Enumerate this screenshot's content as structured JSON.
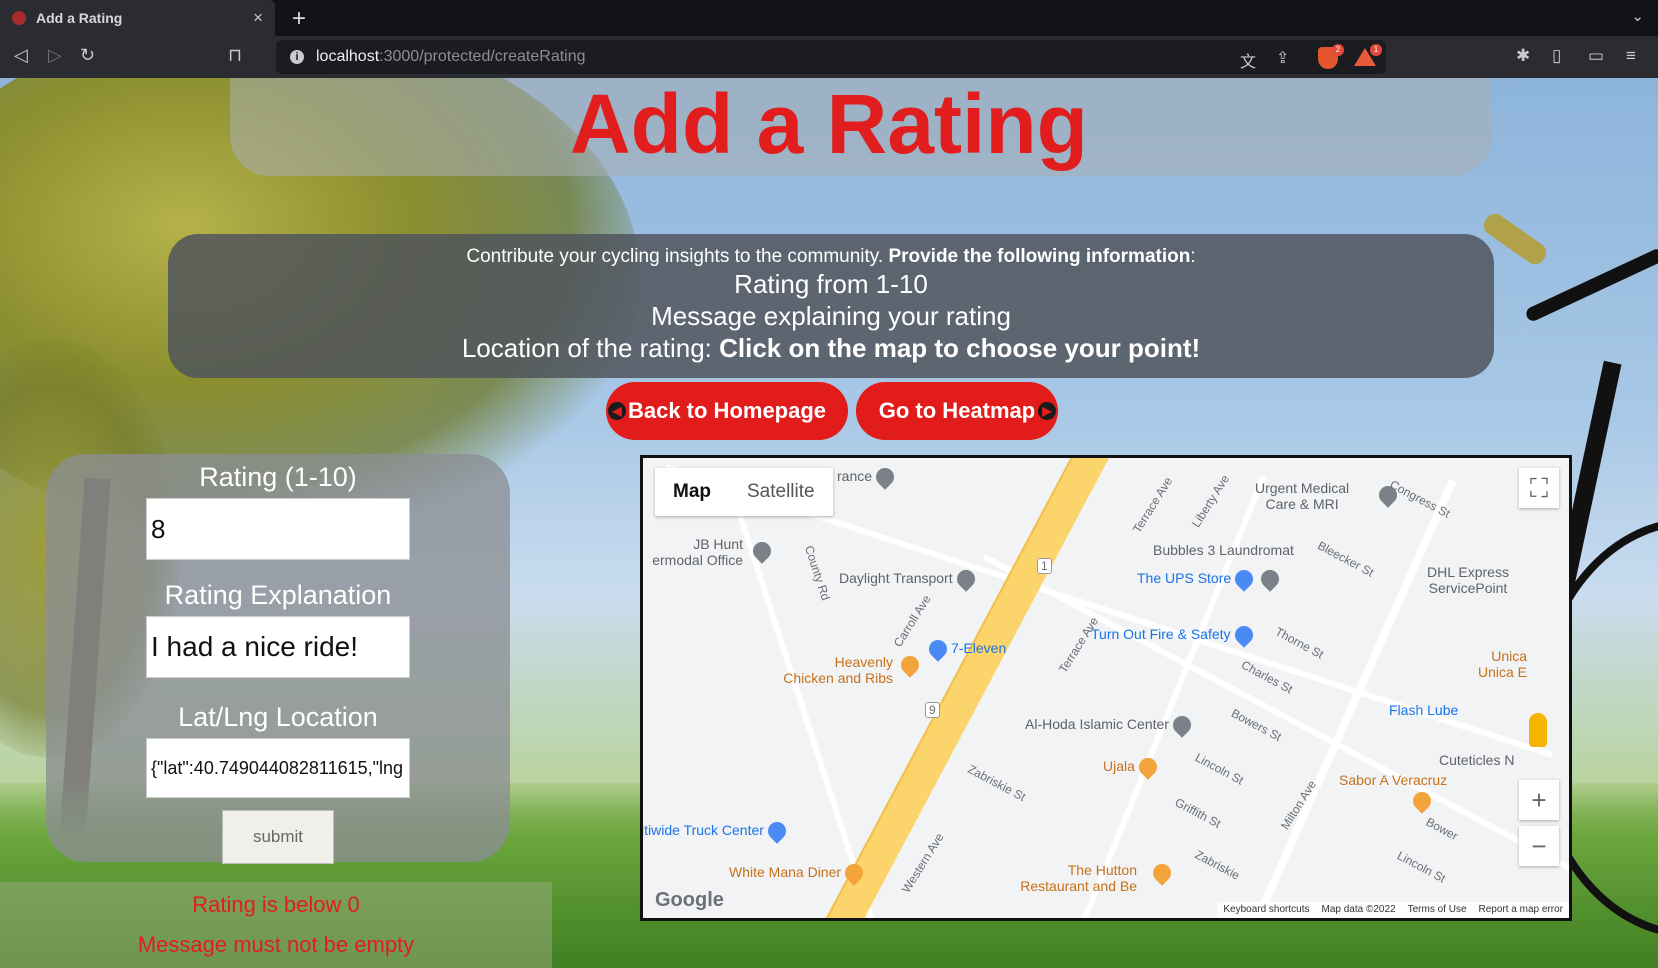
{
  "browser": {
    "tab_title": "Add a Rating",
    "tab_close": "×",
    "new_tab": "+",
    "url_host": "localhost",
    "url_path": ":3000/protected/createRating",
    "shield_badge": "2",
    "rewards_badge": "1"
  },
  "page": {
    "title": "Add a Rating",
    "info_line1_normal": "Contribute your cycling insights to the community. ",
    "info_line1_bold": "Provide the following information",
    "info_line1_colon": ":",
    "info_line2": "Rating from 1-10",
    "info_line3": "Message explaining your rating",
    "info_line4_normal": "Location of the rating: ",
    "info_line4_bold": "Click on the map to choose your point!",
    "back_button": "Back to Homepage",
    "heatmap_button": "Go to Heatmap"
  },
  "form": {
    "rating_label": "Rating (1-10)",
    "rating_value": "8",
    "explanation_label": "Rating Explanation",
    "explanation_value": "I had a nice ride!",
    "location_label": "Lat/Lng Location",
    "location_value": "{\"lat\":40.749044082811615,\"lng",
    "submit_label": "submit"
  },
  "errors": [
    "Rating is below 0",
    "Message must not be empty"
  ],
  "map": {
    "type_map": "Map",
    "type_satellite": "Satellite",
    "zoom_in": "+",
    "zoom_out": "−",
    "fullscreen": "⛶",
    "google": "Google",
    "footer": [
      "Keyboard shortcuts",
      "Map data ©2022",
      "Terms of Use",
      "Report a map error"
    ],
    "places": {
      "p1": "rance",
      "p2": "Urgent Medical",
      "p2b": "Care & MRI",
      "p3": "JB Hunt",
      "p3b": "ermodal Office",
      "p4": "Daylight Transport",
      "p5": "Bubbles 3 Laundromat",
      "p6": "The UPS Store",
      "p7": "DHL Express",
      "p7b": "ServicePoint",
      "p8": "7-Eleven",
      "p9": "Turn Out Fire & Safety",
      "p10": "Heavenly",
      "p10b": "Chicken and Ribs",
      "p11": "Al-Hoda Islamic Center",
      "p12": "Flash Lube",
      "p13": "Unica",
      "p13b": "Unica E",
      "p14": "Cuteticles N",
      "p15": "Ujala",
      "p16": "Sabor A Veracruz",
      "p17": "itiwide Truck Center",
      "p18": "White Mana Diner",
      "p19": "The Hutton",
      "p19b": "Restaurant and Be"
    },
    "streets": {
      "s1": "Terrace Ave",
      "s2": "Liberty Ave",
      "s3": "Congress St",
      "s4": "Bleecker St",
      "s5": "County Rd",
      "s6": "Carroll Ave",
      "s7": "Terrace Ave",
      "s8": "Thorne St",
      "s9": "Charles St",
      "s10": "Bowers St",
      "s11": "Lincoln St",
      "s12": "Zabriskie St",
      "s13": "Griffith St",
      "s14": "Milton Ave",
      "s15": "Western Ave",
      "s16": "Bower",
      "s17": "Lincoln St",
      "s18": "Zabriskie",
      "s19": "1",
      "s20": "9"
    }
  },
  "colors": {
    "title_red": "#e11d1d",
    "button_red": "#e21b1b",
    "highway": "#fbd46b"
  }
}
